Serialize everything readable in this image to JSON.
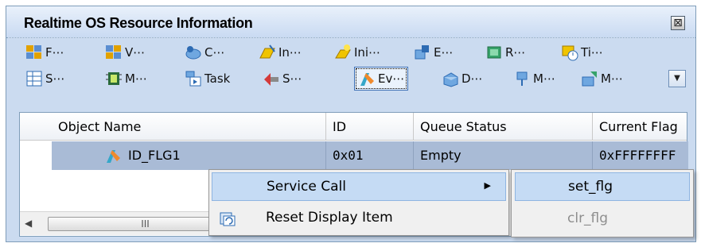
{
  "window": {
    "title": "Realtime OS Resource Information",
    "close_glyph": "⊠"
  },
  "toolbar": {
    "row1": [
      {
        "label": "F⋯",
        "icon": "features-icon"
      },
      {
        "label": "V⋯",
        "icon": "version-icon"
      },
      {
        "label": "C⋯",
        "icon": "context-icon"
      },
      {
        "label": "In⋯",
        "icon": "interrupt-icon"
      },
      {
        "label": "Ini⋯",
        "icon": "initial-handler-icon"
      },
      {
        "label": "E⋯",
        "icon": "exception-icon"
      },
      {
        "label": "R⋯",
        "icon": "ready-queue-icon"
      },
      {
        "label": "Ti⋯",
        "icon": "timer-icon"
      }
    ],
    "row2": [
      {
        "label": "S⋯",
        "icon": "semaphore-icon"
      },
      {
        "label": "M⋯",
        "icon": "memory-icon"
      },
      {
        "label": "Task",
        "icon": "task-icon"
      },
      {
        "label": "S⋯",
        "icon": "scheduler-icon"
      },
      {
        "label": "Ev⋯",
        "icon": "eventflag-icon",
        "selected": true
      },
      {
        "label": "D⋯",
        "icon": "dataqueue-icon"
      },
      {
        "label": "M⋯",
        "icon": "mailbox-icon"
      },
      {
        "label": "M⋯",
        "icon": "message-buffer-icon"
      }
    ],
    "dropdown_glyph": "▼"
  },
  "grid": {
    "columns": [
      "Object Name",
      "ID",
      "Queue Status",
      "Current Flag"
    ],
    "row": {
      "indicator": "▶ •",
      "name": "ID_FLG1",
      "id": "0x01",
      "queue_status": "Empty",
      "current_flag": "0xFFFFFFFF"
    },
    "hscroll_thumb_glyph": "III",
    "hscroll_left_glyph": "◀"
  },
  "context_menu": {
    "items": [
      {
        "label": "Service Call",
        "has_submenu": true,
        "highlighted": true
      },
      {
        "label": "Reset Display Item",
        "icon": "reset-display-icon"
      }
    ],
    "submenu_arrow": "▶"
  },
  "submenu": {
    "items": [
      {
        "label": "set_flg",
        "highlighted": true,
        "enabled": true
      },
      {
        "label": "clr_flg",
        "enabled": false
      }
    ]
  },
  "colors": {
    "panel_bg": "#cbdbf0",
    "selected_row": "#a9bbd6",
    "menu_highlight": "#c5dbf4"
  }
}
